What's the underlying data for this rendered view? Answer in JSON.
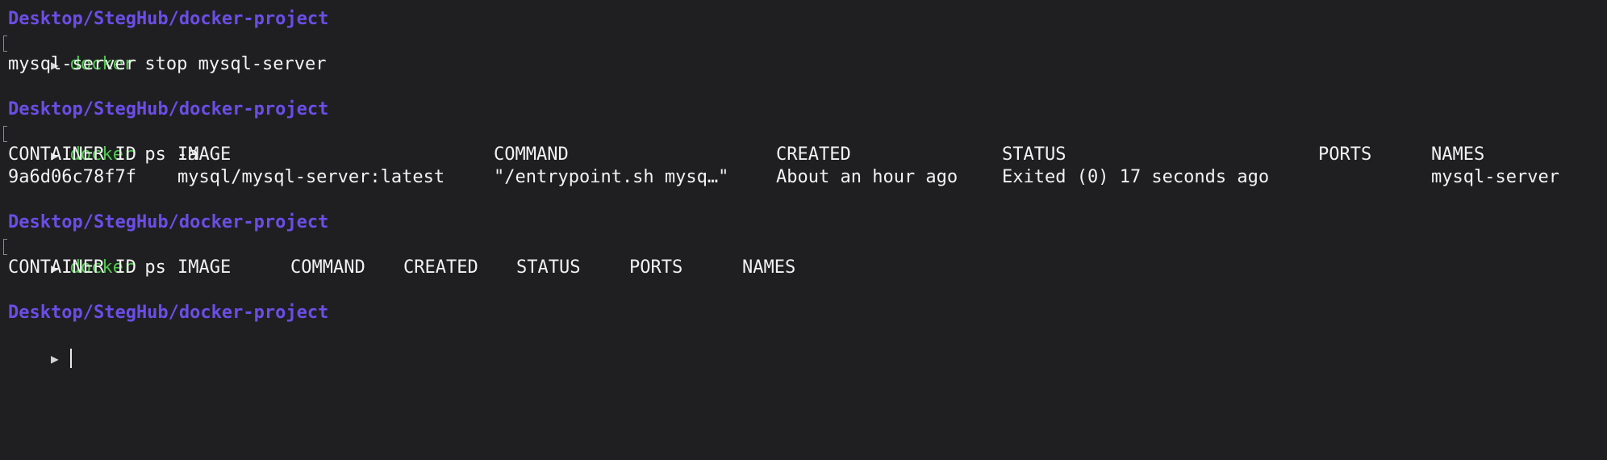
{
  "terminal": {
    "blocks": [
      {
        "path": "Desktop/StegHub/docker-project",
        "prompt_symbol": "▶",
        "command_name": "docker",
        "command_args": "stop mysql-server",
        "output": [
          "mysql-server"
        ]
      },
      {
        "path": "Desktop/StegHub/docker-project",
        "prompt_symbol": "▶",
        "command_name": "docker",
        "command_args": "ps -a",
        "table": {
          "headers": [
            "CONTAINER ID",
            "IMAGE",
            "COMMAND",
            "CREATED",
            "STATUS",
            "PORTS",
            "NAMES"
          ],
          "rows": [
            [
              "9a6d06c78f7f",
              "mysql/mysql-server:latest",
              "\"/entrypoint.sh mysq…\"",
              "About an hour ago",
              "Exited (0) 17 seconds ago",
              "",
              "mysql-server"
            ]
          ]
        }
      },
      {
        "path": "Desktop/StegHub/docker-project",
        "prompt_symbol": "▶",
        "command_name": "docker",
        "command_args": "ps",
        "table": {
          "headers": [
            "CONTAINER ID",
            "IMAGE",
            "COMMAND",
            "CREATED",
            "STATUS",
            "PORTS",
            "NAMES"
          ],
          "rows": []
        }
      },
      {
        "path": "Desktop/StegHub/docker-project",
        "prompt_symbol": "▶"
      }
    ]
  },
  "colors": {
    "background": "#1f1f22",
    "path": "#6b4ee6",
    "command": "#4cc94c",
    "text": "#f2f2f2"
  }
}
